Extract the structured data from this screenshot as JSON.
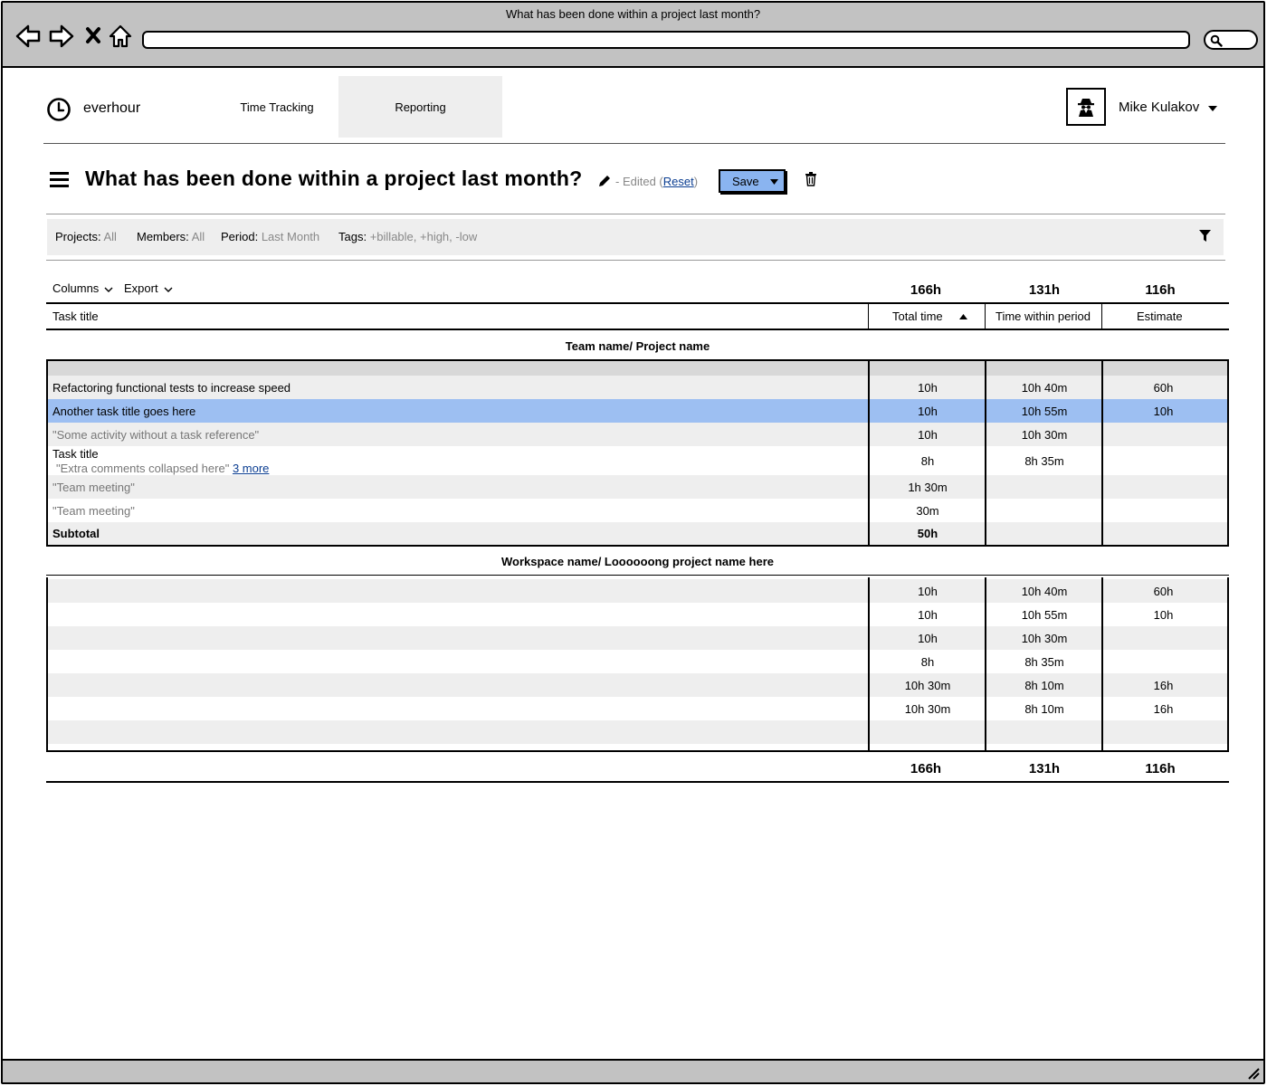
{
  "window": {
    "title": "What has been done within a project last month?"
  },
  "header": {
    "logo_text": "everhour",
    "tabs": [
      {
        "label": "Time Tracking",
        "active": false
      },
      {
        "label": "Reporting",
        "active": true
      }
    ],
    "user_name": "Mike Kulakov"
  },
  "report": {
    "title": "What has been done within a project last month?",
    "edited_prefix": "- Edited (",
    "reset_label": "Reset",
    "edited_suffix": ")",
    "save_label": "Save"
  },
  "filters": [
    {
      "key": "Projects:",
      "value": "All"
    },
    {
      "key": "Members:",
      "value": "All"
    },
    {
      "key": "Period:",
      "value": "Last Month"
    },
    {
      "key": "Tags:",
      "value": "+billable, +high, -low"
    }
  ],
  "toolbar": {
    "columns_label": "Columns",
    "export_label": "Export"
  },
  "totals": {
    "total_time": "166h",
    "within_period": "131h",
    "estimate": "116h"
  },
  "columns": {
    "task": "Task title",
    "total": "Total time",
    "period": "Time within period",
    "estimate": "Estimate"
  },
  "groups": [
    {
      "title": "Team name/ Project name",
      "rows": [
        {
          "title": "Refactoring functional tests to increase speed",
          "total": "10h",
          "period": "10h 40m",
          "estimate": "60h"
        },
        {
          "title": "Another task title goes here",
          "total": "10h",
          "period": "10h 55m",
          "estimate": "10h"
        },
        {
          "title": "\"Some activity without a task reference\"",
          "total": "10h",
          "period": "10h 30m",
          "estimate": ""
        },
        {
          "title": "Task title",
          "comment": "\"Extra comments collapsed here\"",
          "more_link": "3 more",
          "total": "8h",
          "period": "8h 35m",
          "estimate": ""
        },
        {
          "title": "\"Team meeting\"",
          "total": "1h 30m",
          "period": "",
          "estimate": ""
        },
        {
          "title": "\"Team meeting\"",
          "total": "30m",
          "period": "",
          "estimate": ""
        },
        {
          "title": "Subtotal",
          "total": "50h",
          "period": "",
          "estimate": ""
        }
      ]
    },
    {
      "title": "Workspace name/ Loooooong project name here",
      "rows": [
        {
          "title": "",
          "total": "10h",
          "period": "10h 40m",
          "estimate": "60h"
        },
        {
          "title": "",
          "total": "10h",
          "period": "10h 55m",
          "estimate": "10h"
        },
        {
          "title": "",
          "total": "10h",
          "period": "10h 30m",
          "estimate": ""
        },
        {
          "title": "",
          "total": "8h",
          "period": "8h 35m",
          "estimate": ""
        },
        {
          "title": "",
          "total": "10h 30m",
          "period": "8h 10m",
          "estimate": "16h"
        },
        {
          "title": "",
          "total": "10h 30m",
          "period": "8h 10m",
          "estimate": "16h"
        },
        {
          "title": "",
          "total": "",
          "period": "",
          "estimate": ""
        }
      ]
    }
  ],
  "colors": {
    "selected_row": "#9dbff2",
    "save_button": "#8ab4f0",
    "chrome": "#c2c2c2",
    "stripe": "#eeeeee"
  }
}
